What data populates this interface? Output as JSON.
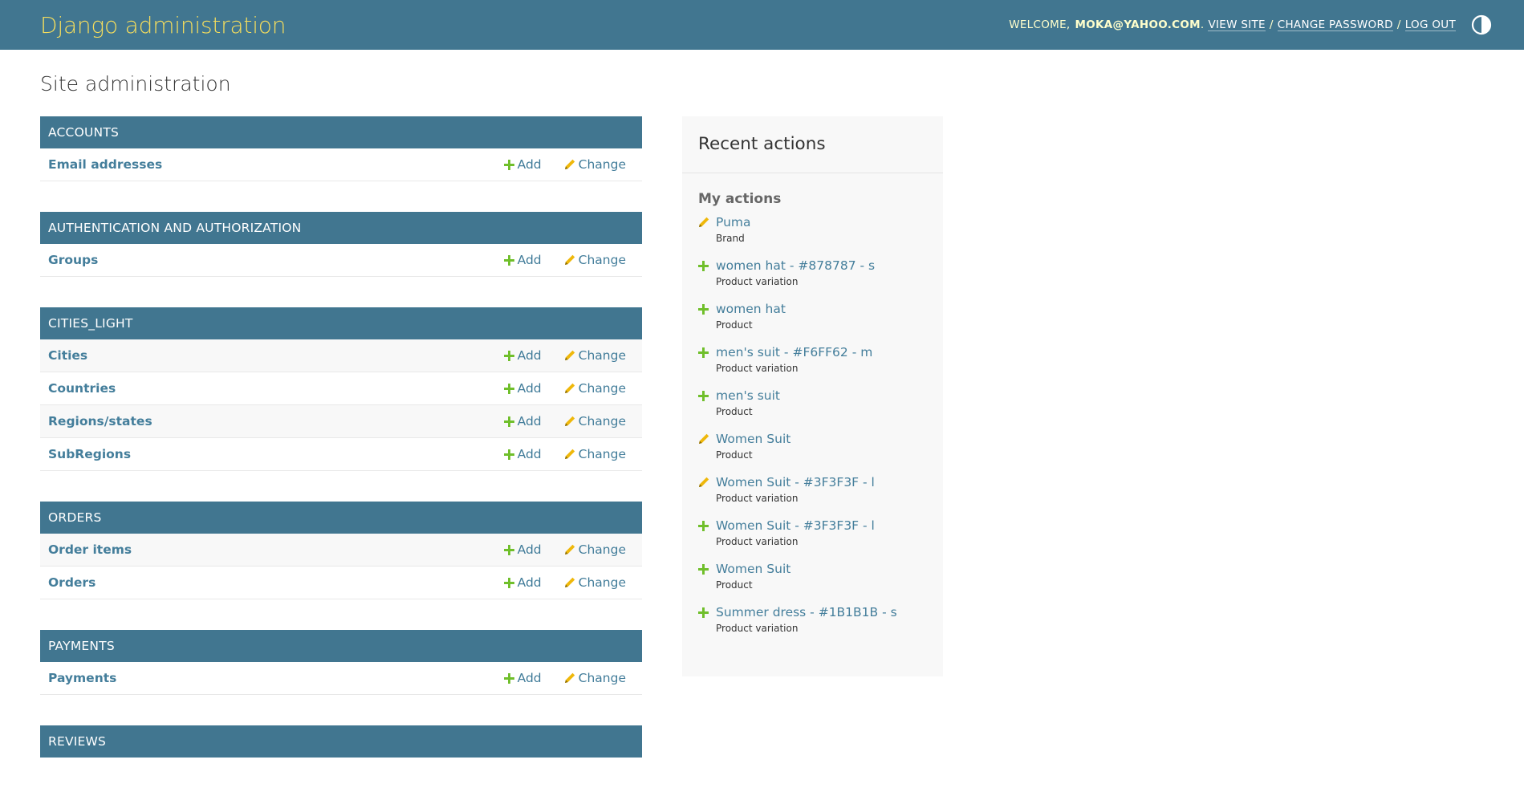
{
  "header": {
    "branding": "Django administration",
    "welcome": "WELCOME,",
    "username": "MOKA@YAHOO.COM",
    "view_site": "VIEW SITE",
    "change_password": "CHANGE PASSWORD",
    "log_out": "LOG OUT",
    "separator": "/",
    "period": "."
  },
  "page_title": "Site administration",
  "labels": {
    "add": "Add",
    "change": "Change"
  },
  "modules": [
    {
      "caption": "ACCOUNTS",
      "models": [
        "Email addresses"
      ]
    },
    {
      "caption": "AUTHENTICATION AND AUTHORIZATION",
      "models": [
        "Groups"
      ]
    },
    {
      "caption": "CITIES_LIGHT",
      "models": [
        "Cities",
        "Countries",
        "Regions/states",
        "SubRegions"
      ]
    },
    {
      "caption": "ORDERS",
      "models": [
        "Order items",
        "Orders"
      ]
    },
    {
      "caption": "PAYMENTS",
      "models": [
        "Payments"
      ]
    },
    {
      "caption": "REVIEWS",
      "models": []
    }
  ],
  "recent_actions": {
    "title": "Recent actions",
    "my_actions": "My actions",
    "items": [
      {
        "icon": "pencil-icon",
        "name": "Puma",
        "type": "Brand"
      },
      {
        "icon": "plus-icon",
        "name": "women hat - #878787 - s",
        "type": "Product variation"
      },
      {
        "icon": "plus-icon",
        "name": "women hat",
        "type": "Product"
      },
      {
        "icon": "plus-icon",
        "name": "men's suit - #F6FF62 - m",
        "type": "Product variation"
      },
      {
        "icon": "plus-icon",
        "name": "men's suit",
        "type": "Product"
      },
      {
        "icon": "pencil-icon",
        "name": "Women Suit",
        "type": "Product"
      },
      {
        "icon": "pencil-icon",
        "name": "Women Suit - #3F3F3F - l",
        "type": "Product variation"
      },
      {
        "icon": "plus-icon",
        "name": "Women Suit - #3F3F3F - l",
        "type": "Product variation"
      },
      {
        "icon": "plus-icon",
        "name": "Women Suit",
        "type": "Product"
      },
      {
        "icon": "plus-icon",
        "name": "Summer dress - #1B1B1B - s",
        "type": "Product variation"
      }
    ]
  },
  "colors": {
    "header_bg": "#417690",
    "branding": "#f5dd5d",
    "link": "#447e9b",
    "add_icon": "#70bf2b",
    "change_icon": "#efb80b"
  }
}
